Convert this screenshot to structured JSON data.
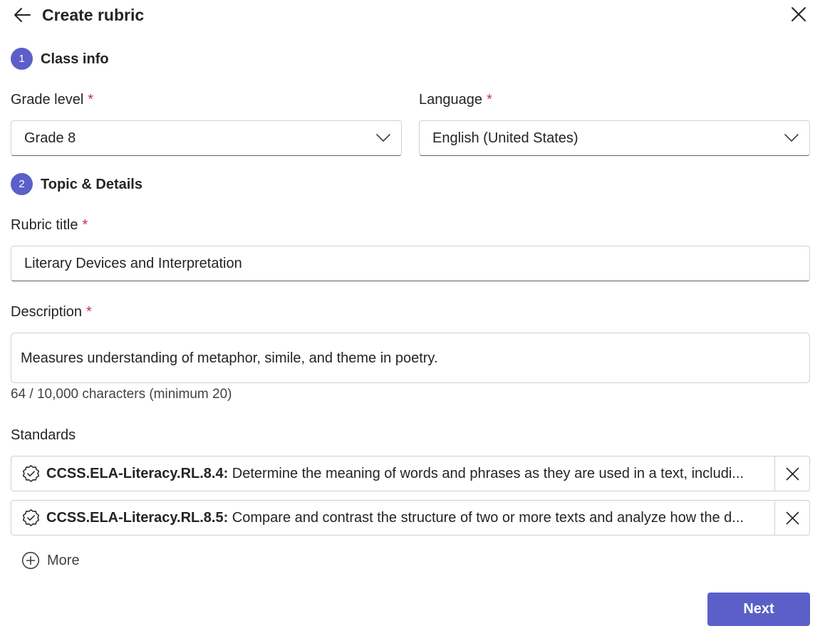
{
  "header": {
    "title": "Create rubric",
    "back_icon": "arrow-left-icon",
    "close_icon": "close-icon"
  },
  "steps": [
    {
      "number": "1",
      "title": "Class info"
    },
    {
      "number": "2",
      "title": "Topic & Details"
    }
  ],
  "grade_level": {
    "label": "Grade level",
    "required_mark": "*",
    "value": "Grade 8"
  },
  "language": {
    "label": "Language",
    "required_mark": "*",
    "value": "English (United States)"
  },
  "rubric_title": {
    "label": "Rubric title",
    "required_mark": "*",
    "value": "Literary Devices and Interpretation"
  },
  "description": {
    "label": "Description",
    "required_mark": "*",
    "value": "Measures understanding of metaphor, simile, and theme in poetry.",
    "char_count": "64 / 10,000 characters (minimum 20)"
  },
  "standards": {
    "label": "Standards",
    "items": [
      {
        "code": "CCSS.ELA-Literacy.RL.8.4:",
        "text": " Determine the meaning of words and phrases as they are used in a text, includi..."
      },
      {
        "code": "CCSS.ELA-Literacy.RL.8.5:",
        "text": " Compare and contrast the structure of two or more texts and analyze how the d..."
      }
    ],
    "more_label": "More"
  },
  "footer": {
    "next_label": "Next"
  },
  "colors": {
    "accent": "#5b5fc7",
    "required": "#c4314b",
    "border": "#d1d1d1"
  }
}
